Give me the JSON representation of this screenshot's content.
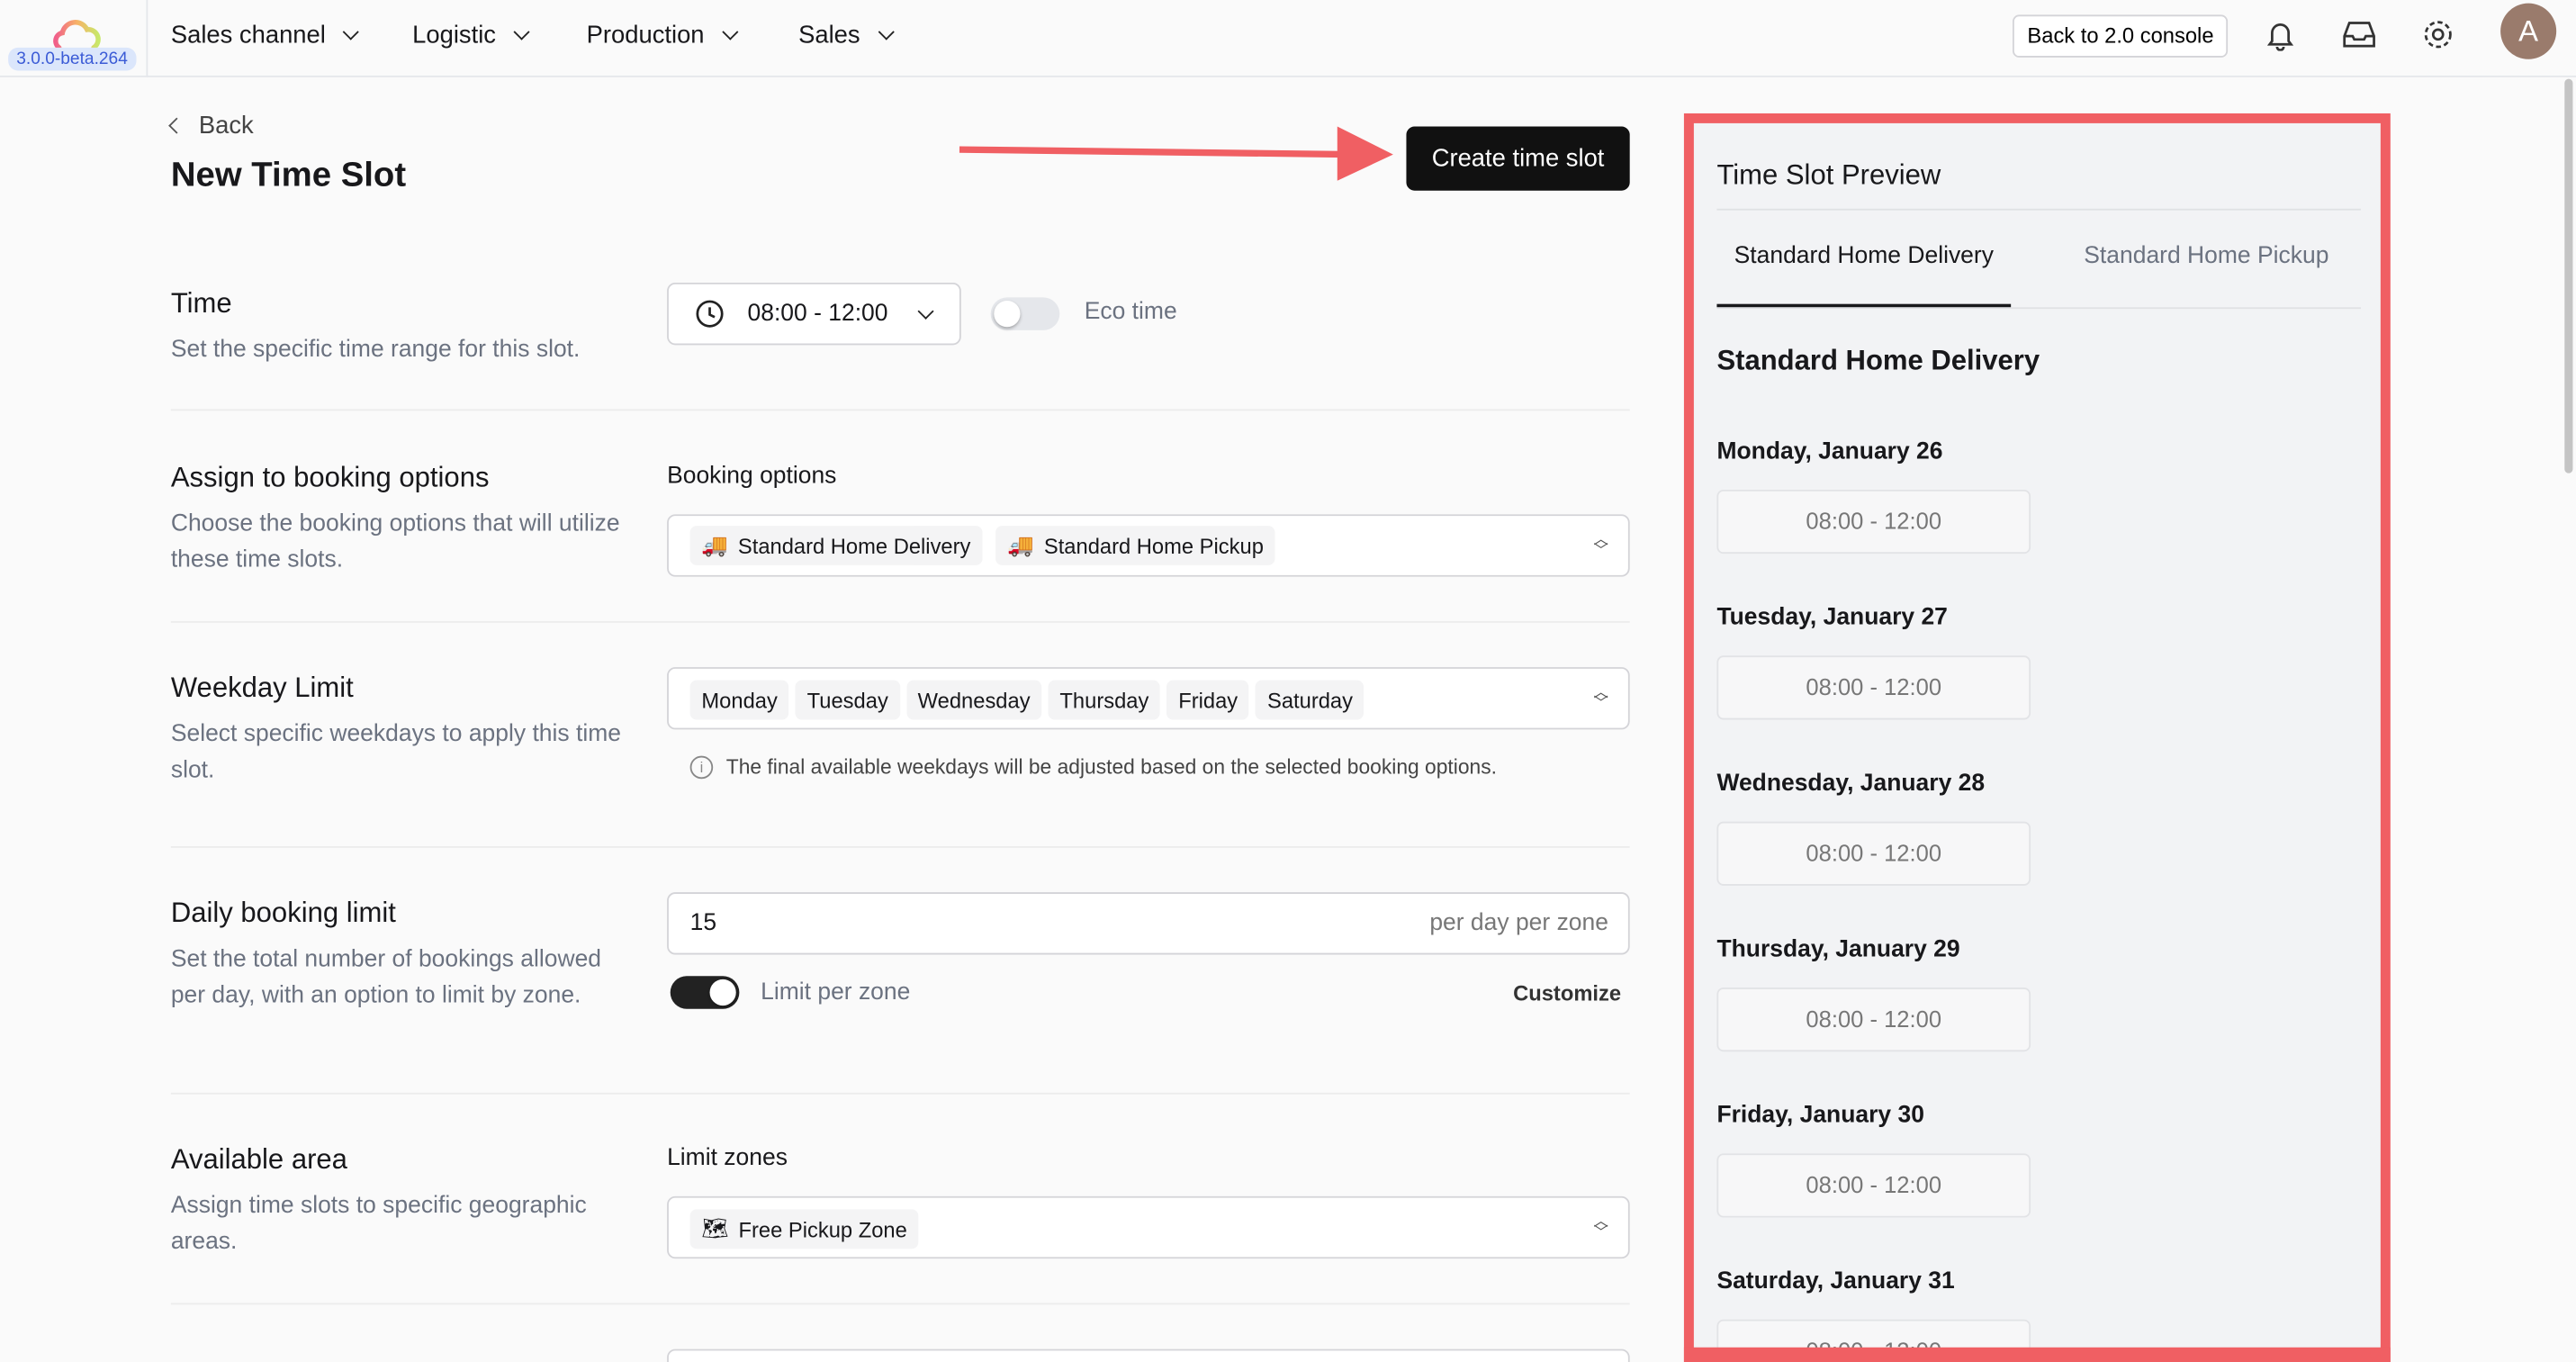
{
  "app": {
    "version": "3.0.0-beta.264",
    "avatar_initial": "A",
    "back_console": "Back to 2.0 console"
  },
  "nav": [
    "Sales channel",
    "Logistic",
    "Production",
    "Sales"
  ],
  "page": {
    "back": "Back",
    "title": "New Time Slot",
    "create_button": "Create time slot"
  },
  "time": {
    "title": "Time",
    "desc": "Set the specific time range for this slot.",
    "value": "08:00 - 12:00",
    "eco_label": "Eco time",
    "eco_on": false
  },
  "booking": {
    "title": "Assign to booking options",
    "desc": "Choose the booking options that will utilize these time slots.",
    "label": "Booking options",
    "chips": [
      "Standard Home Delivery",
      "Standard Home Pickup"
    ]
  },
  "weekday": {
    "title": "Weekday Limit",
    "desc": "Select specific weekdays to apply this time slot.",
    "chips": [
      "Monday",
      "Tuesday",
      "Wednesday",
      "Thursday",
      "Friday",
      "Saturday"
    ],
    "note": "The final available weekdays will be adjusted based on the selected booking options."
  },
  "daily": {
    "title": "Daily booking limit",
    "desc": "Set the total number of bookings allowed per day, with an option to limit by zone.",
    "value": "15",
    "suffix": "per day per zone",
    "limit_label": "Limit per zone",
    "limit_on": true,
    "customize": "Customize"
  },
  "area": {
    "title": "Available area",
    "desc": "Assign time slots to specific geographic areas.",
    "label": "Limit zones",
    "chips": [
      "Free Pickup Zone"
    ]
  },
  "preview": {
    "title": "Time Slot Preview",
    "tabs": [
      "Standard Home Delivery",
      "Standard Home Pickup"
    ],
    "active_tab": 0,
    "heading": "Standard Home Delivery",
    "days": [
      {
        "date": "Monday, January 26",
        "slot": "08:00 - 12:00"
      },
      {
        "date": "Tuesday, January 27",
        "slot": "08:00 - 12:00"
      },
      {
        "date": "Wednesday, January 28",
        "slot": "08:00 - 12:00"
      },
      {
        "date": "Thursday, January 29",
        "slot": "08:00 - 12:00"
      },
      {
        "date": "Friday, January 30",
        "slot": "08:00 - 12:00"
      },
      {
        "date": "Saturday, January 31",
        "slot": "08:00 - 12:00"
      }
    ]
  },
  "colors": {
    "highlight": "#f05f63",
    "primary": "#18181b"
  }
}
